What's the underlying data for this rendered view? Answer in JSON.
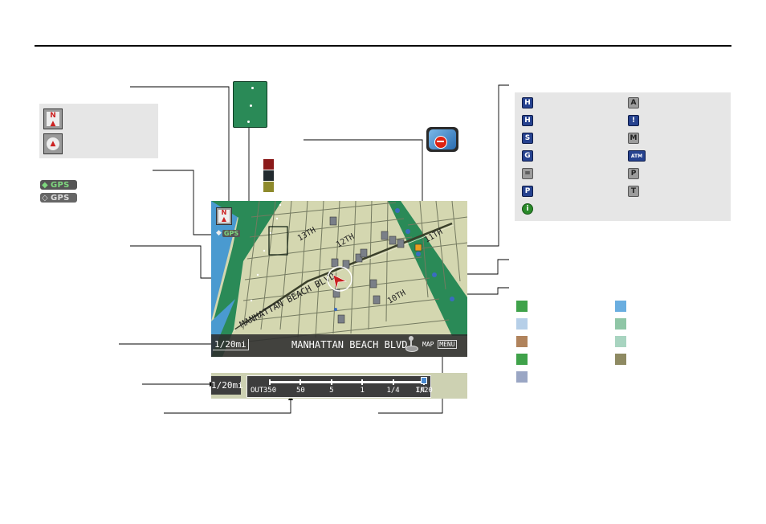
{
  "map": {
    "street_name": "MANHATTAN BEACH BLVD",
    "scale_label": "1/20mi",
    "map_menu_map": "MAP",
    "map_menu_menu": "MENU",
    "street_labels": [
      "13TH",
      "12TH",
      "11TH",
      "10TH",
      "MANHATTAN BEACH BLVD"
    ],
    "gps_indicator": "GPS",
    "north_label": "N"
  },
  "legend_modes": {
    "north_up_label": "N",
    "gps_labels": [
      "GPS",
      "GPS"
    ]
  },
  "scale_bar": {
    "label": "1/20mi",
    "out_label": "OUT",
    "in_label": "IN",
    "ticks": [
      "350",
      "50",
      "5",
      "1",
      "1/4",
      "1/20"
    ],
    "selected_index": 5
  },
  "poi_icons": [
    {
      "name": "honda-dealer-icon",
      "glyph": "H",
      "col": "left"
    },
    {
      "name": "acura-dealer-icon",
      "glyph": "A",
      "col": "right"
    },
    {
      "name": "hospital-icon",
      "glyph": "H",
      "col": "left"
    },
    {
      "name": "construction-icon",
      "glyph": "!",
      "col": "right"
    },
    {
      "name": "shopping-icon",
      "glyph": "S",
      "col": "left"
    },
    {
      "name": "museum-icon",
      "glyph": "M",
      "col": "right"
    },
    {
      "name": "gas-station-icon",
      "glyph": "G",
      "col": "left"
    },
    {
      "name": "atm-icon",
      "glyph": "ATM",
      "col": "right"
    },
    {
      "name": "hotel-icon",
      "glyph": "=",
      "col": "left"
    },
    {
      "name": "parking-icon",
      "glyph": "P",
      "col": "right"
    },
    {
      "name": "post-office-icon",
      "glyph": "P",
      "col": "left"
    },
    {
      "name": "train-station-icon",
      "glyph": "T",
      "col": "right"
    },
    {
      "name": "information-icon",
      "glyph": "i",
      "col": "left"
    }
  ],
  "color_swatches": {
    "traffic": [
      "#8b1a1a",
      "#222a2e",
      "#8e8a2c"
    ],
    "map_colors_left": [
      "#3fa24a",
      "#b6cfe8",
      "#b0835c",
      "#3fa24a",
      "#9aa6c4"
    ],
    "map_colors_right": [
      "#6aaee0",
      "#8fc6a6",
      "#a8d4c0",
      "#8e8a62"
    ]
  },
  "colors": {
    "map_land": "#d4d7b0",
    "map_water": "#4a9ad0",
    "map_park": "#2a8a57",
    "lcd_bar": "#3d3d3d"
  }
}
